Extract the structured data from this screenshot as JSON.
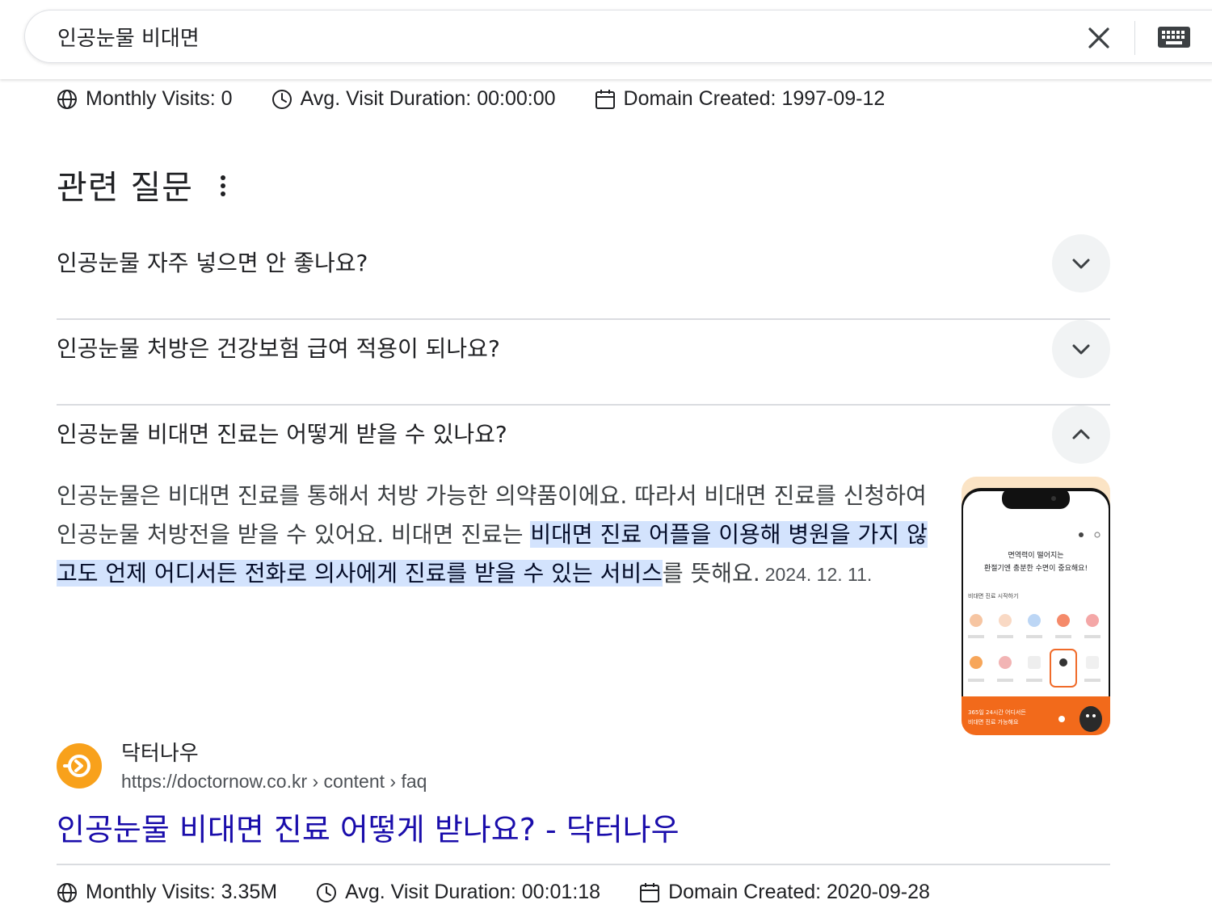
{
  "search": {
    "query": "인공눈물 비대면"
  },
  "stats_top": {
    "monthly_visits": "Monthly Visits: 0",
    "avg_duration": "Avg. Visit Duration: 00:00:00",
    "domain_created": "Domain Created: 1997-09-12"
  },
  "related": {
    "title": "관련 질문",
    "questions": [
      {
        "text": "인공눈물 자주 넣으면 안 좋나요?",
        "expanded": false
      },
      {
        "text": "인공눈물 처방은 건강보험 급여 적용이 되나요?",
        "expanded": false
      },
      {
        "text": "인공눈물 비대면 진료는 어떻게 받을 수 있나요?",
        "expanded": true
      }
    ]
  },
  "answer": {
    "part1": "인공눈물은 비대면 진료를 통해서 처방 가능한 의약품이에요. 따라서 비대면 진료를 신청하여 인공눈물 처방전을 받을 수 있어요. 비대면 진료는 ",
    "highlight": "비대면 진료 어플을 이용해 병원을 가지 않고도 언제 어디서든 전화로 의사에게 진료를 받을 수 있는 서비스",
    "part2": "를 뜻해요.",
    "date": "2024. 12. 11."
  },
  "thumbnail": {
    "headline_1": "면역력이 떨어지는",
    "headline_2": "환절기엔 충분한 수면이 중요해요!",
    "section": "비대면 진료 시작하기",
    "banner_1": "365일 24시간 어디서든",
    "banner_2": "비대면 진료 가능해요"
  },
  "source": {
    "name": "닥터나우",
    "url": "https://doctornow.co.kr › content › faq",
    "title": "인공눈물 비대면 진료 어떻게 받나요? - 닥터나우"
  },
  "stats_bottom": {
    "monthly_visits": "Monthly Visits: 3.35M",
    "avg_duration": "Avg. Visit Duration: 00:01:18",
    "domain_created": "Domain Created: 2020-09-28"
  },
  "colors": {
    "link": "#1a0dab",
    "highlight": "#d3e3fd",
    "brand_orange": "#f8a11b"
  }
}
